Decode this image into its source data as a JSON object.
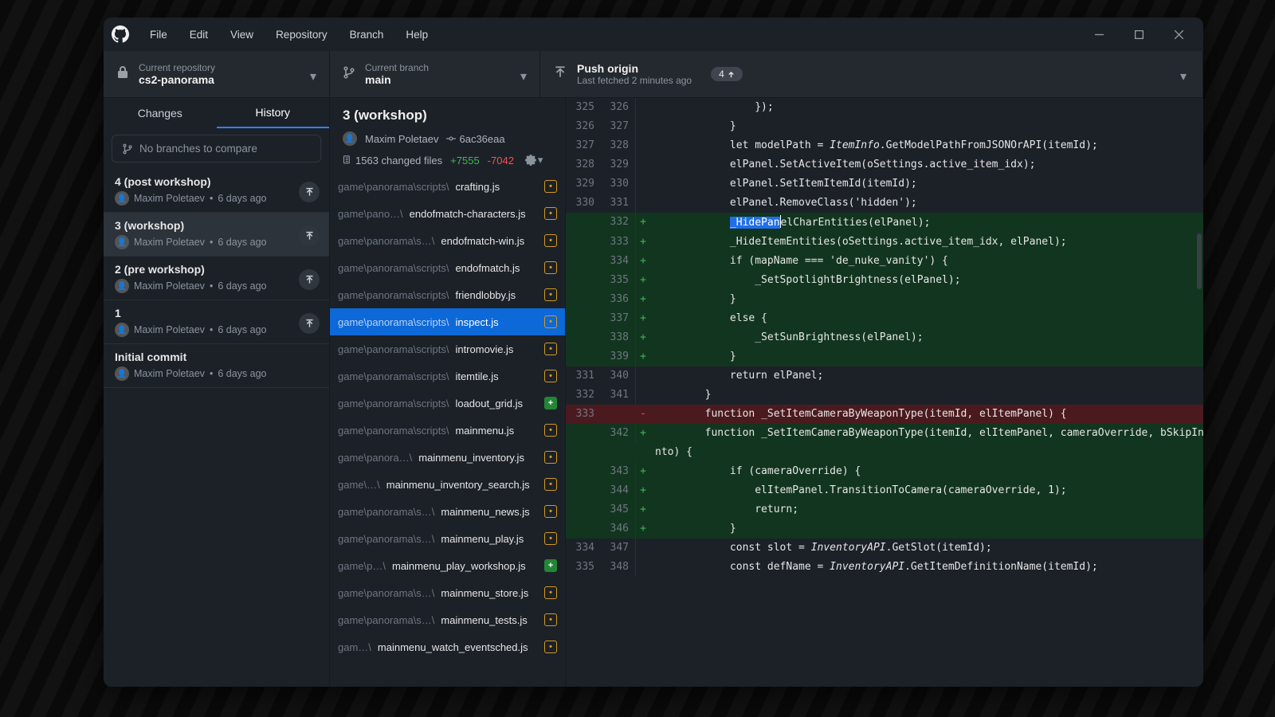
{
  "menu": {
    "file": "File",
    "edit": "Edit",
    "view": "View",
    "repository": "Repository",
    "branch": "Branch",
    "help": "Help"
  },
  "toolbar": {
    "repo_label": "Current repository",
    "repo_value": "cs2-panorama",
    "branch_label": "Current branch",
    "branch_value": "main",
    "push_title": "Push origin",
    "push_sub": "Last fetched 2 minutes ago",
    "push_count": "4"
  },
  "tabs": {
    "changes": "Changes",
    "history": "History"
  },
  "compare_placeholder": "No branches to compare",
  "commits": [
    {
      "title": "4 (post workshop)",
      "author": "Maxim Poletaev",
      "when": "6 days ago"
    },
    {
      "title": "3 (workshop)",
      "author": "Maxim Poletaev",
      "when": "6 days ago",
      "selected": true
    },
    {
      "title": "2 (pre workshop)",
      "author": "Maxim Poletaev",
      "when": "6 days ago"
    },
    {
      "title": "1",
      "author": "Maxim Poletaev",
      "when": "6 days ago"
    },
    {
      "title": "Initial commit",
      "author": "Maxim Poletaev",
      "when": "6 days ago",
      "nopush": true
    }
  ],
  "detail": {
    "title": "3 (workshop)",
    "author": "Maxim Poletaev",
    "sha": "6ac36eaa",
    "changed": "1563 changed files",
    "adds": "+7555",
    "dels": "-7042"
  },
  "files": [
    {
      "dim": "game\\panorama\\scripts\\",
      "name": "crafting.js",
      "kind": "mod"
    },
    {
      "dim": "game\\pano…\\",
      "name": "endofmatch-characters.js",
      "kind": "mod"
    },
    {
      "dim": "game\\panorama\\s…\\",
      "name": "endofmatch-win.js",
      "kind": "mod"
    },
    {
      "dim": "game\\panorama\\scripts\\",
      "name": "endofmatch.js",
      "kind": "mod"
    },
    {
      "dim": "game\\panorama\\scripts\\",
      "name": "friendlobby.js",
      "kind": "mod"
    },
    {
      "dim": "game\\panorama\\scripts\\",
      "name": "inspect.js",
      "kind": "mod",
      "selected": true
    },
    {
      "dim": "game\\panorama\\scripts\\",
      "name": "intromovie.js",
      "kind": "mod"
    },
    {
      "dim": "game\\panorama\\scripts\\",
      "name": "itemtile.js",
      "kind": "mod"
    },
    {
      "dim": "game\\panorama\\scripts\\",
      "name": "loadout_grid.js",
      "kind": "add"
    },
    {
      "dim": "game\\panorama\\scripts\\",
      "name": "mainmenu.js",
      "kind": "mod"
    },
    {
      "dim": "game\\panora…\\",
      "name": "mainmenu_inventory.js",
      "kind": "mod"
    },
    {
      "dim": "game\\…\\",
      "name": "mainmenu_inventory_search.js",
      "kind": "mod"
    },
    {
      "dim": "game\\panorama\\s…\\",
      "name": "mainmenu_news.js",
      "kind": "mod"
    },
    {
      "dim": "game\\panorama\\s…\\",
      "name": "mainmenu_play.js",
      "kind": "mod"
    },
    {
      "dim": "game\\p…\\",
      "name": "mainmenu_play_workshop.js",
      "kind": "add"
    },
    {
      "dim": "game\\panorama\\s…\\",
      "name": "mainmenu_store.js",
      "kind": "mod"
    },
    {
      "dim": "game\\panorama\\s…\\",
      "name": "mainmenu_tests.js",
      "kind": "mod"
    },
    {
      "dim": "gam…\\",
      "name": "mainmenu_watch_eventsched.js",
      "kind": "mod"
    }
  ],
  "diff": [
    {
      "o": "325",
      "n": "326",
      "t": "ctx",
      "code": "                });"
    },
    {
      "o": "326",
      "n": "327",
      "t": "ctx",
      "code": "            }"
    },
    {
      "o": "327",
      "n": "328",
      "t": "ctx",
      "code": "            <kw>let</kw> <id>modelPath</id> = <var>ItemInfo</var>.<fn>GetModelPathFromJSONOrAPI</fn>(<id>itemId</id>);"
    },
    {
      "o": "328",
      "n": "329",
      "t": "ctx",
      "code": "            <id>elPanel</id>.<fn>SetActiveItem</fn>(<id>oSettings</id>.<id>active_item_idx</id>);"
    },
    {
      "o": "329",
      "n": "330",
      "t": "ctx",
      "code": "            <id>elPanel</id>.<fn>SetItemItemId</fn>(<id>itemId</id>);"
    },
    {
      "o": "330",
      "n": "331",
      "t": "ctx",
      "code": "            <id>elPanel</id>.<fn>RemoveClass</fn>(<str>'hidden'</str>);"
    },
    {
      "o": "",
      "n": "332",
      "t": "add",
      "code": "            <span class='sel'>_HidePan</span><span class='text-cursor'></span><fn>elCharEntities</fn>(<id>elPanel</id>);"
    },
    {
      "o": "",
      "n": "333",
      "t": "add",
      "code": "            <fn>_HideItemEntities</fn>(<id>oSettings</id>.<id>active_item_idx</id>, <id>elPanel</id>);"
    },
    {
      "o": "",
      "n": "334",
      "t": "add",
      "code": "            <kw>if</kw> (<id>mapName</id> === <str>'de_nuke_vanity'</str>) {"
    },
    {
      "o": "",
      "n": "335",
      "t": "add",
      "code": "                <fn>_SetSpotlightBrightness</fn>(<id>elPanel</id>);"
    },
    {
      "o": "",
      "n": "336",
      "t": "add",
      "code": "            }"
    },
    {
      "o": "",
      "n": "337",
      "t": "add",
      "code": "            <kw>else</kw> {"
    },
    {
      "o": "",
      "n": "338",
      "t": "add",
      "code": "                <fn>_SetSunBrightness</fn>(<id>elPanel</id>);"
    },
    {
      "o": "",
      "n": "339",
      "t": "add",
      "code": "            }"
    },
    {
      "o": "331",
      "n": "340",
      "t": "ctx",
      "code": "            <kw>return</kw> <id>elPanel</id>;"
    },
    {
      "o": "332",
      "n": "341",
      "t": "ctx",
      "code": "        }"
    },
    {
      "o": "333",
      "n": "",
      "t": "del",
      "code": "        <kw>function</kw> <fn>_SetItemCameraByWeaponType</fn>(<id>itemId</id>, <id>elItemPanel</id>) {"
    },
    {
      "o": "",
      "n": "342",
      "t": "add",
      "code": "        <kw>function</kw> <fn>_SetItemCameraByWeaponType</fn>(<id>itemId</id>, <id>elItemPanel</id>, <id>cameraOverride</id>, <id>bSkipIn</id>\n<id>nto</id>) {"
    },
    {
      "o": "",
      "n": "343",
      "t": "add",
      "code": "            <kw>if</kw> (<id>cameraOverride</id>) {"
    },
    {
      "o": "",
      "n": "344",
      "t": "add",
      "code": "                <id>elItemPanel</id>.<fn>TransitionToCamera</fn>(<id>cameraOverride</id>, <num>1</num>);"
    },
    {
      "o": "",
      "n": "345",
      "t": "add",
      "code": "                <kw>return</kw>;"
    },
    {
      "o": "",
      "n": "346",
      "t": "add",
      "code": "            }"
    },
    {
      "o": "334",
      "n": "347",
      "t": "ctx",
      "code": "            <kw>const</kw> <id>slot</id> = <var>InventoryAPI</var>.<fn>GetSlot</fn>(<id>itemId</id>);"
    },
    {
      "o": "335",
      "n": "348",
      "t": "ctx",
      "code": "            <kw>const</kw> <id>defName</id> = <var>InventoryAPI</var>.<fn>GetItemDefinitionName</fn>(<id>itemId</id>);"
    }
  ]
}
